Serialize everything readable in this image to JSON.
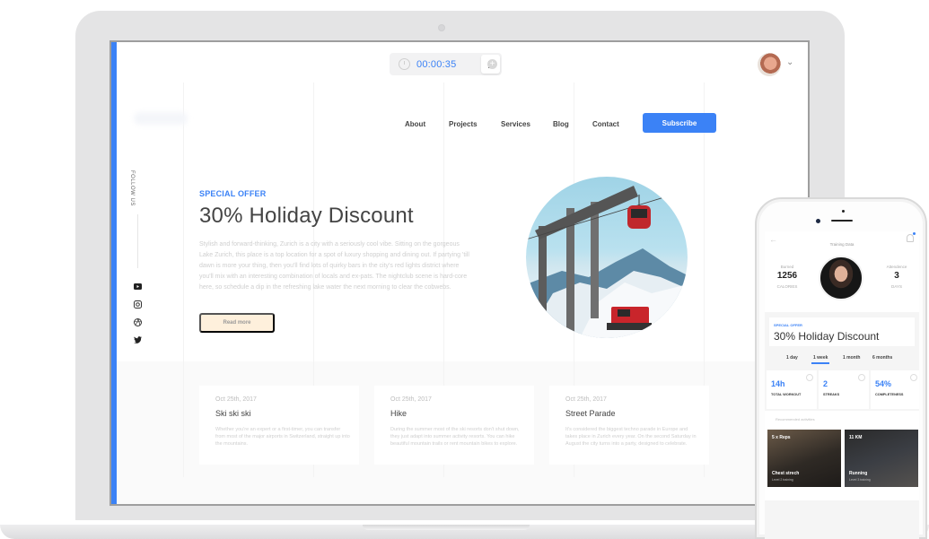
{
  "timer": {
    "elapsed": "00:00:35",
    "icon": "stopwatch-icon",
    "pause_icon": "pause-icon",
    "add_icon": "plus-circle-icon"
  },
  "header": {
    "avatar_icon": "user-avatar",
    "chevron_icon": "chevron-down-icon"
  },
  "nav": {
    "links": [
      "About",
      "Projects",
      "Services",
      "Blog",
      "Contact"
    ],
    "subscribe_label": "Subscribe"
  },
  "social": {
    "label": "FOLLOW US",
    "icons": [
      "youtube-icon",
      "instagram-icon",
      "dribbble-icon",
      "twitter-icon"
    ]
  },
  "hero": {
    "eyebrow": "SPECIAL OFFER",
    "title": "30% Holiday Discount",
    "body": "Stylish and forward-thinking, Zurich is a city with a seriously cool vibe. Sitting on the gorgeous Lake Zurich, this place is a top location for a spot of luxury shopping and dining out. If partying 'till dawn is more your thing, then you'll find lots of quirky bars in the city's red lights district where you'll mix with an interesting combination of locals and ex-pats. The nightclub scene is hard-core here, so schedule a dip in the refreshing lake water the next morning to clear the cobwebs.",
    "cta_label": "Read more",
    "image": "cable-car-mountain-photo"
  },
  "cards": [
    {
      "date": "Oct 25th, 2017",
      "title": "Ski ski ski",
      "body": "Whether you're an expert or a first-timer, you can transfer from most of the major airports in Switzerland, straight up into the mountains."
    },
    {
      "date": "Oct 25th, 2017",
      "title": "Hike",
      "body": "During the summer most of the ski resorts don't shut down, they just adapt into summer activity resorts. You can hike beautiful mountain trails or rent mountain bikes to explore."
    },
    {
      "date": "Oct 25th, 2017",
      "title": "Street Parade",
      "body": "It's considered the biggest techno parade in Europe and takes place in Zurich every year. On the second Saturday in August the city turns into a party, designed to celebrate."
    }
  ],
  "phone": {
    "title": "Training Data",
    "burned": {
      "label": "Burned",
      "value": "1256",
      "unit": "CALORIES"
    },
    "attendance": {
      "label": "Attendence",
      "value": "3",
      "unit": "DAYS"
    },
    "offer_eyebrow": "SPECIAL OFFER",
    "offer_title": "30% Holiday Discount",
    "tabs": [
      {
        "label": "1 day",
        "active": false
      },
      {
        "label": "1 week",
        "active": true
      },
      {
        "label": "1 month",
        "active": false
      },
      {
        "label": "6 months",
        "active": false
      }
    ],
    "metrics": [
      {
        "value": "14h",
        "label": "TOTAL WORKOUT",
        "icon": "clock-icon"
      },
      {
        "value": "2",
        "label": "STREAKS",
        "icon": "star-icon"
      },
      {
        "value": "54%",
        "label": "COMPLETENESS",
        "icon": "check-circle-icon"
      }
    ],
    "recommended_label": "Recommended activities",
    "activities": [
      {
        "top": "5 x Reps",
        "name": "Chest strech",
        "level": "Level 2 training"
      },
      {
        "top": "11 KM",
        "name": "Running",
        "level": "Level 3 training"
      }
    ]
  },
  "colors": {
    "accent": "#3b82f6",
    "cta_bg": "#fef0dc",
    "device": "#e4e4e5"
  }
}
